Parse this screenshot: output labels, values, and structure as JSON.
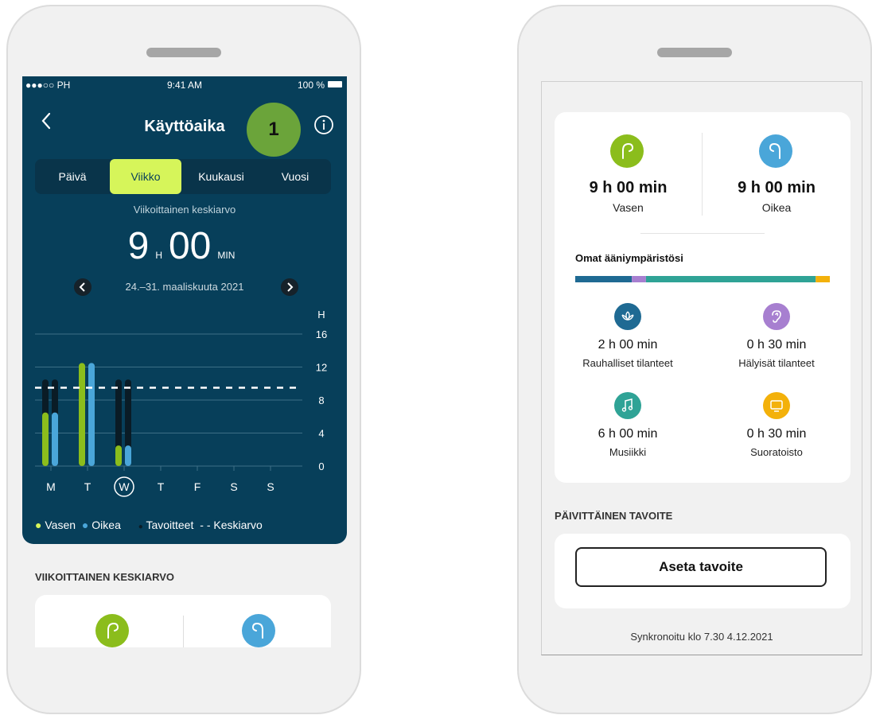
{
  "status_bar": {
    "carrier": "●●●○○ PH",
    "time": "9:41 AM",
    "battery": "100 %"
  },
  "header": {
    "title": "Käyttöaika",
    "badge": "1"
  },
  "tabs": [
    {
      "label": "Päivä",
      "active": false
    },
    {
      "label": "Viikko",
      "active": true
    },
    {
      "label": "Kuukausi",
      "active": false
    },
    {
      "label": "Vuosi",
      "active": false
    }
  ],
  "summary": {
    "label": "Viikoittainen keskiarvo",
    "hours": "9",
    "hours_unit": "H",
    "minutes": "00",
    "minutes_unit": "MIN",
    "date_range": "24.–31. maaliskuuta 2021"
  },
  "chart_data": {
    "type": "bar",
    "ylabel": "H",
    "yticks": [
      "16",
      "12",
      "8",
      "4",
      "0"
    ],
    "ylim": [
      0,
      16
    ],
    "categories": [
      "M",
      "T",
      "W",
      "T",
      "F",
      "S",
      "S"
    ],
    "selected_category_index": 2,
    "series": [
      {
        "name": "Vasen",
        "color": "#8bbd1c",
        "values": [
          6.5,
          12.5,
          2.5,
          null,
          null,
          null,
          null
        ]
      },
      {
        "name": "Oikea",
        "color": "#4aa6d9",
        "values": [
          6.5,
          12.5,
          2.5,
          null,
          null,
          null,
          null
        ]
      },
      {
        "name": "Tavoitteet",
        "color": "#0a1c26",
        "values": [
          10.5,
          10.5,
          10.5,
          null,
          null,
          null,
          null
        ]
      }
    ],
    "average": 9.5,
    "legend": [
      {
        "label": "Vasen",
        "color": "#d6f55a"
      },
      {
        "label": "Oikea",
        "color": "#4aa6d9"
      },
      {
        "label": "Tavoitteet",
        "color": "#0a1c26"
      },
      {
        "label": "Keskiarvo",
        "color": "#ffffff"
      }
    ]
  },
  "left_lower": {
    "section_title": "VIIKOITTAINEN KESKIARVO"
  },
  "devices": {
    "left": {
      "value": "9 h 00 min",
      "label": "Vasen",
      "icon": "left-hearing-aid-icon",
      "color": "#8bbd1c"
    },
    "right": {
      "value": "9 h 00 min",
      "label": "Oikea",
      "icon": "right-hearing-aid-icon",
      "color": "#4aa6d9"
    }
  },
  "environments": {
    "title": "Omat ääniympäristösi",
    "bar_colors": [
      "#1f6a93",
      "#a77fd0",
      "#2fa396",
      "#f3b10b"
    ],
    "items": [
      {
        "value": "2 h 00 min",
        "label": "Rauhalliset tilanteet",
        "icon": "lotus-icon",
        "color": "#1f6a93"
      },
      {
        "value": "0 h 30 min",
        "label": "Hälyisät tilanteet",
        "icon": "ear-icon",
        "color": "#a77fd0"
      },
      {
        "value": "6 h 00 min",
        "label": "Musiikki",
        "icon": "music-note-icon",
        "color": "#2fa396"
      },
      {
        "value": "0 h 30 min",
        "label": "Suoratoisto",
        "icon": "tv-icon",
        "color": "#f3b10b"
      }
    ]
  },
  "goal": {
    "section_title": "PÄIVITTÄINEN TAVOITE",
    "button": "Aseta tavoite"
  },
  "sync": {
    "text": "Synkronoitu klo 7.30 4.12.2021"
  }
}
